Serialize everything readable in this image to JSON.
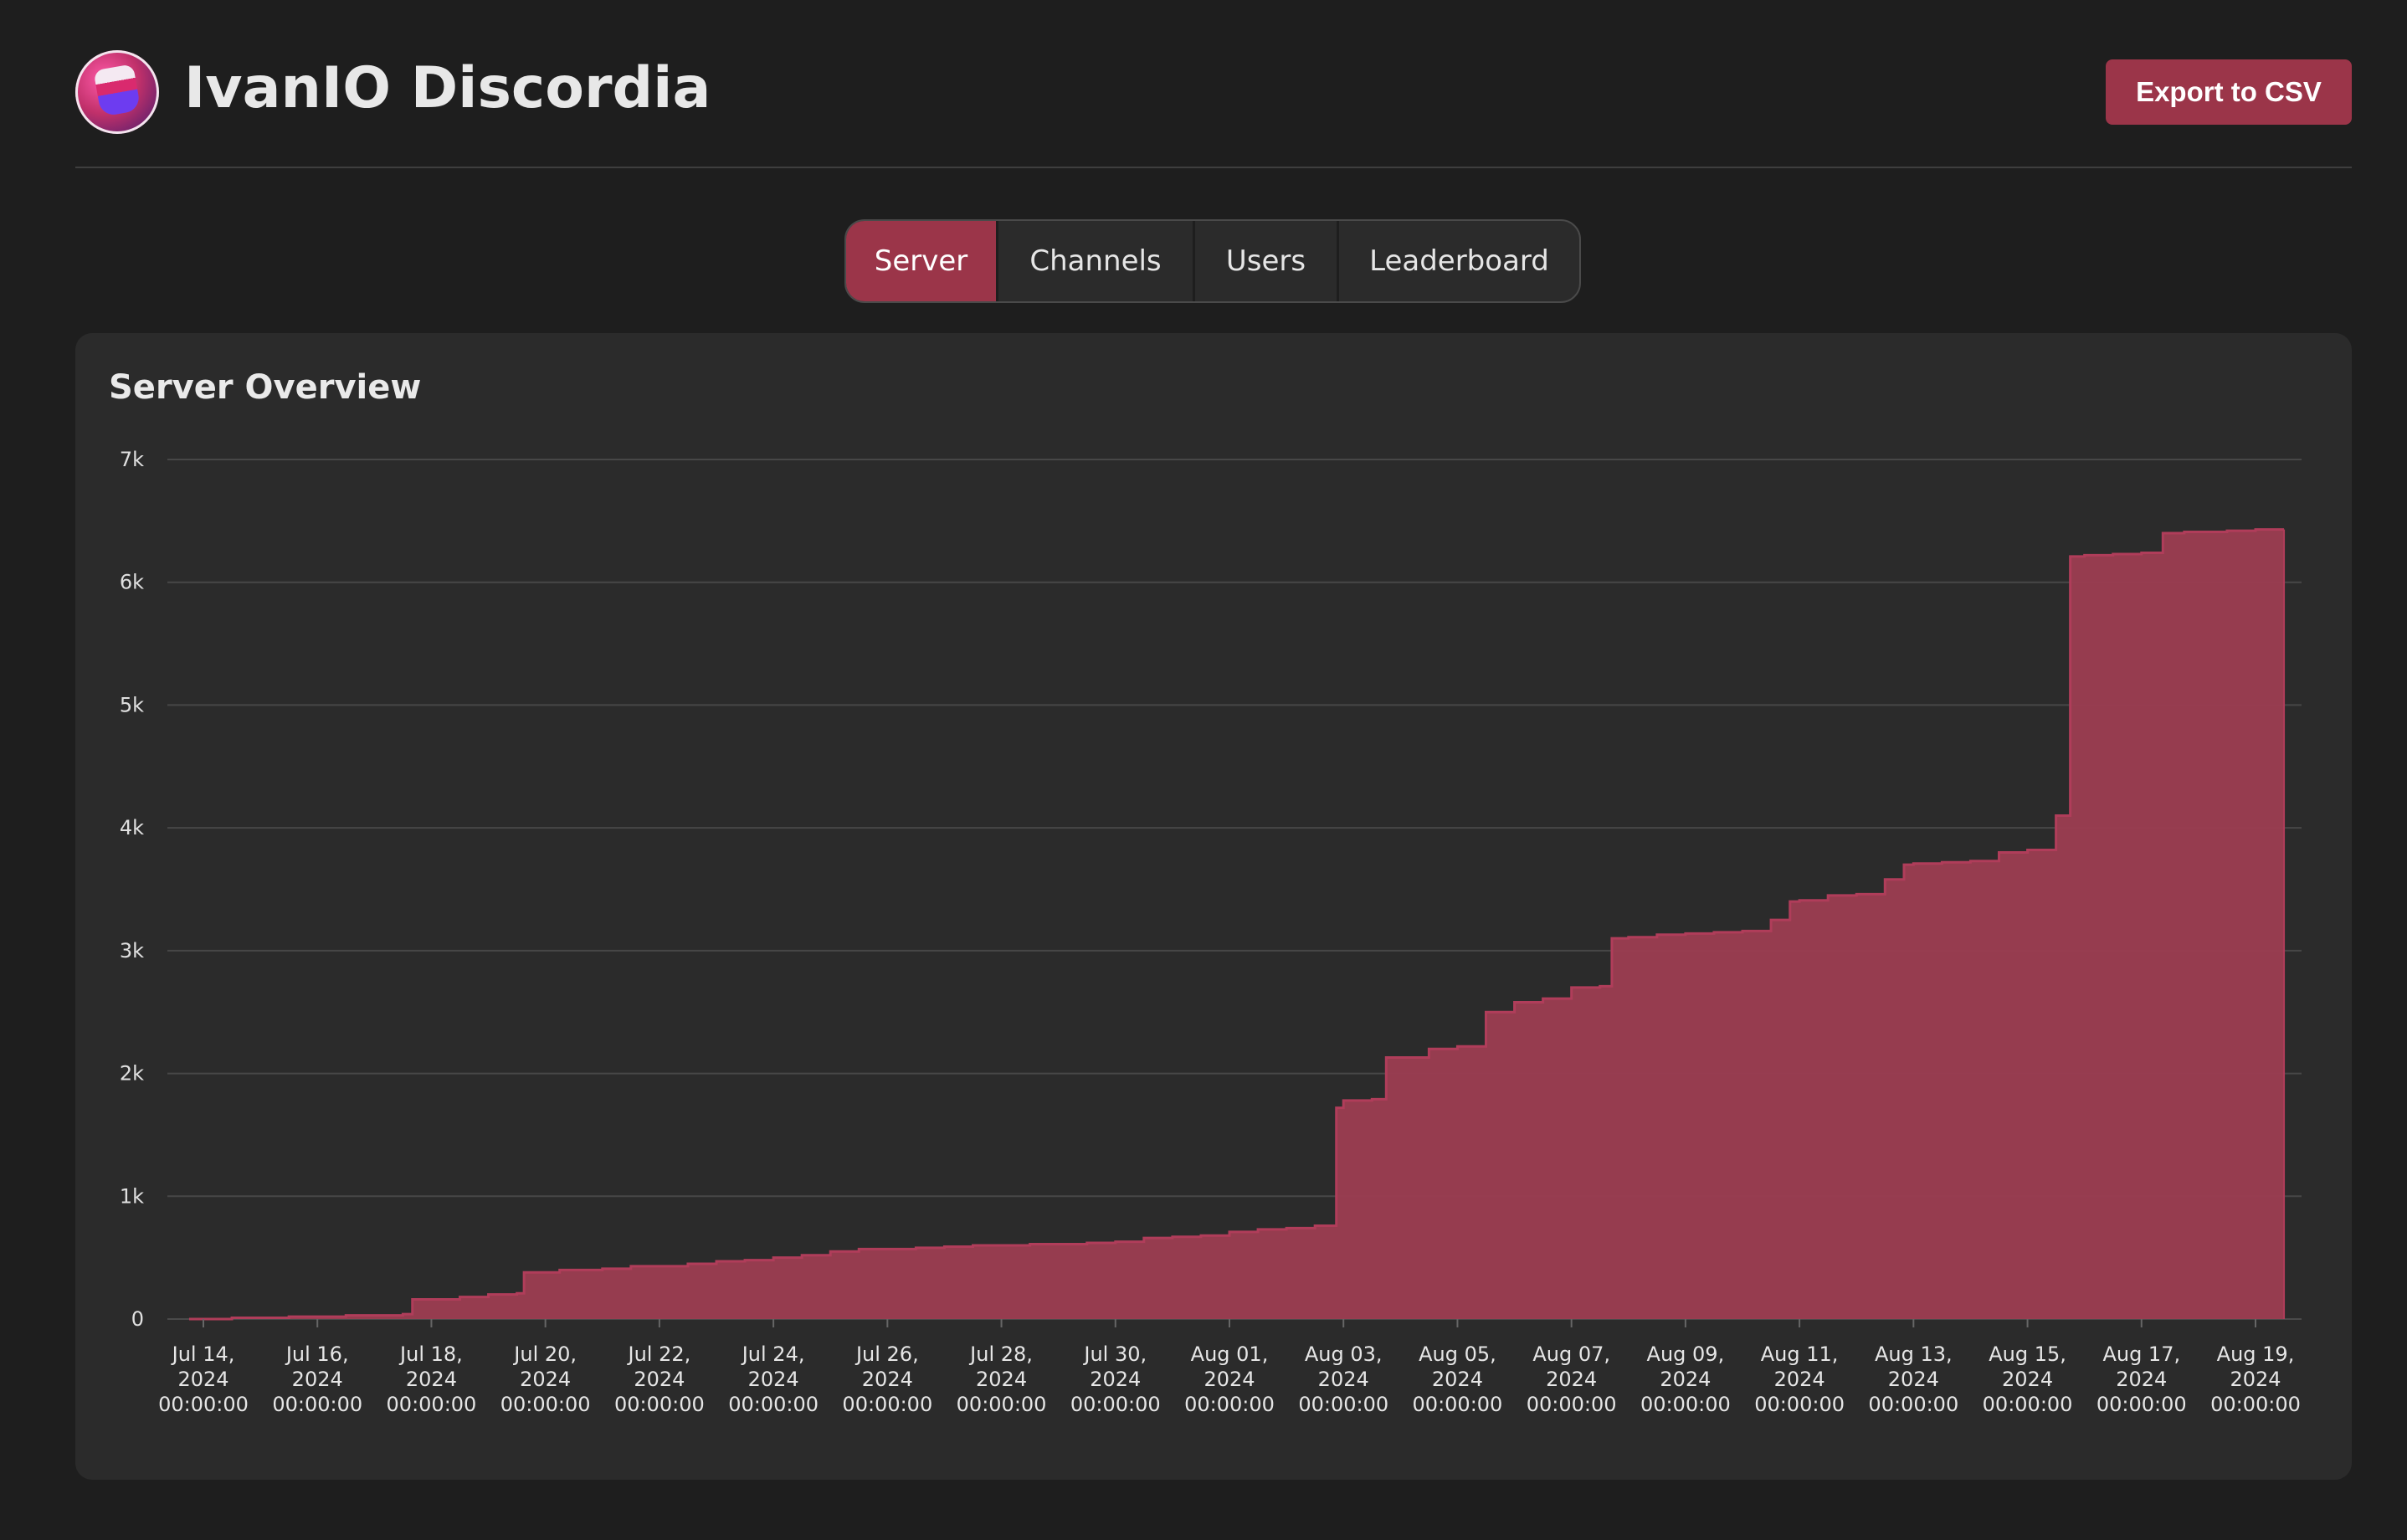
{
  "app": {
    "title": "IvanIO Discordia",
    "logo_icon": "discordia-logo-icon"
  },
  "toolbar": {
    "export_label": "Export to CSV"
  },
  "tabs": [
    {
      "label": "Server",
      "active": true
    },
    {
      "label": "Channels",
      "active": false
    },
    {
      "label": "Users",
      "active": false
    },
    {
      "label": "Leaderboard",
      "active": false
    }
  ],
  "colors": {
    "accent": "#9b3549",
    "area_fill": "#9c3d51",
    "area_line": "#b03d5a",
    "background": "#1e1e1e",
    "card": "#2b2b2b"
  },
  "chart_data": {
    "type": "area",
    "title": "Server Overview",
    "xlabel": "",
    "ylabel": "",
    "ylim": [
      0,
      7000
    ],
    "y_ticks": [
      "0",
      "1k",
      "2k",
      "3k",
      "4k",
      "5k",
      "6k",
      "7k"
    ],
    "y_tick_values": [
      0,
      1000,
      2000,
      3000,
      4000,
      5000,
      6000,
      7000
    ],
    "grid": true,
    "x_tick_labels": [
      "Jul 14, 2024 00:00:00",
      "Jul 16, 2024 00:00:00",
      "Jul 18, 2024 00:00:00",
      "Jul 20, 2024 00:00:00",
      "Jul 22, 2024 00:00:00",
      "Jul 24, 2024 00:00:00",
      "Jul 26, 2024 00:00:00",
      "Jul 28, 2024 00:00:00",
      "Jul 30, 2024 00:00:00",
      "Aug 01, 2024 00:00:00",
      "Aug 03, 2024 00:00:00",
      "Aug 05, 2024 00:00:00",
      "Aug 07, 2024 00:00:00",
      "Aug 09, 2024 00:00:00",
      "Aug 11, 2024 00:00:00",
      "Aug 13, 2024 00:00:00",
      "Aug 15, 2024 00:00:00",
      "Aug 17, 2024 00:00:00",
      "Aug 19, 2024 00:00:00"
    ],
    "series": [
      {
        "x": [
          "2024-07-13T18:00",
          "2024-07-14T12:00",
          "2024-07-15T12:00",
          "2024-07-16T12:00",
          "2024-07-17T12:00",
          "2024-07-17T16:00",
          "2024-07-18T12:00",
          "2024-07-19T00:00",
          "2024-07-19T12:00",
          "2024-07-19T15:00",
          "2024-07-20T06:00",
          "2024-07-21T00:00",
          "2024-07-21T12:00",
          "2024-07-22T12:00",
          "2024-07-23T00:00",
          "2024-07-23T12:00",
          "2024-07-24T00:00",
          "2024-07-24T12:00",
          "2024-07-25T00:00",
          "2024-07-25T12:00",
          "2024-07-26T12:00",
          "2024-07-27T00:00",
          "2024-07-27T12:00",
          "2024-07-28T12:00",
          "2024-07-29T12:00",
          "2024-07-30T00:00",
          "2024-07-30T12:00",
          "2024-07-31T00:00",
          "2024-07-31T12:00",
          "2024-08-01T00:00",
          "2024-08-01T12:00",
          "2024-08-02T00:00",
          "2024-08-02T12:00",
          "2024-08-02T21:00",
          "2024-08-03T00:00",
          "2024-08-03T12:00",
          "2024-08-03T18:00",
          "2024-08-04T12:00",
          "2024-08-05T00:00",
          "2024-08-05T12:00",
          "2024-08-06T00:00",
          "2024-08-06T12:00",
          "2024-08-07T00:00",
          "2024-08-07T12:00",
          "2024-08-07T17:00",
          "2024-08-08T00:00",
          "2024-08-08T12:00",
          "2024-08-09T00:00",
          "2024-08-09T12:00",
          "2024-08-10T00:00",
          "2024-08-10T12:00",
          "2024-08-10T20:00",
          "2024-08-11T00:00",
          "2024-08-11T12:00",
          "2024-08-12T00:00",
          "2024-08-12T12:00",
          "2024-08-12T20:00",
          "2024-08-13T00:00",
          "2024-08-13T12:00",
          "2024-08-14T00:00",
          "2024-08-14T12:00",
          "2024-08-15T00:00",
          "2024-08-15T12:00",
          "2024-08-15T18:00",
          "2024-08-16T00:00",
          "2024-08-16T12:00",
          "2024-08-17T00:00",
          "2024-08-17T09:00",
          "2024-08-17T18:00",
          "2024-08-18T12:00",
          "2024-08-19T00:00",
          "2024-08-19T12:00"
        ],
        "values": [
          0,
          10,
          20,
          30,
          40,
          160,
          180,
          200,
          210,
          380,
          400,
          410,
          430,
          450,
          470,
          480,
          500,
          520,
          550,
          570,
          580,
          590,
          600,
          610,
          620,
          630,
          660,
          670,
          680,
          710,
          730,
          740,
          760,
          1720,
          1780,
          1790,
          2130,
          2200,
          2220,
          2500,
          2580,
          2610,
          2700,
          2710,
          3100,
          3110,
          3130,
          3140,
          3150,
          3160,
          3250,
          3400,
          3410,
          3450,
          3460,
          3580,
          3700,
          3710,
          3720,
          3730,
          3800,
          3820,
          4100,
          6210,
          6220,
          6230,
          6240,
          6400,
          6410,
          6420,
          6430,
          6430
        ]
      }
    ]
  }
}
